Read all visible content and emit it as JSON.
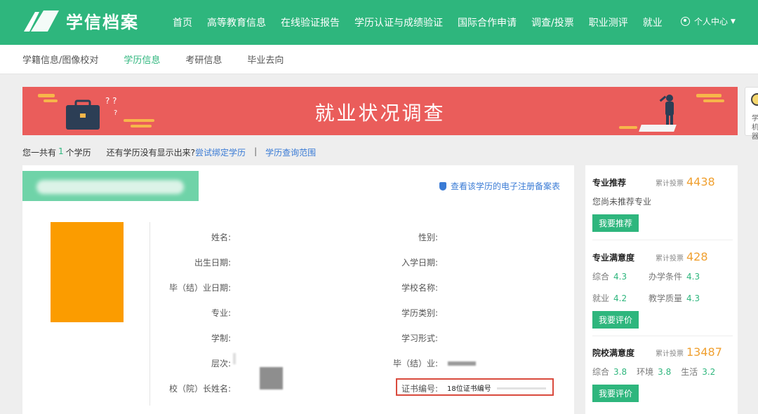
{
  "app": {
    "logo_text": "学信档案",
    "brand_color": "#2eb67d"
  },
  "nav": {
    "items": [
      "首页",
      "高等教育信息",
      "在线验证报告",
      "学历认证与成绩验证",
      "国际合作申请",
      "调查/投票",
      "职业测评",
      "就业"
    ],
    "user_menu": "个人中心"
  },
  "subnav": {
    "items": [
      "学籍信息/图像校对",
      "学历信息",
      "考研信息",
      "毕业去向"
    ],
    "active_index": 1
  },
  "banner": {
    "title": "就业状况调查",
    "color": "#ea5d5b"
  },
  "side_widget": {
    "label_1": "学",
    "label_2": "机器"
  },
  "info": {
    "prefix": "您一共有",
    "count": "1",
    "suffix": "个学历",
    "question": "还有学历没有显示出来?",
    "bind_link": "尝试绑定学历",
    "separator": "|",
    "scope_link": "学历查询范围"
  },
  "record": {
    "record_link": "查看该学历的电子注册备案表",
    "fields_left": [
      "姓名:",
      "出生日期:",
      "毕（结）业日期:",
      "专业:",
      "学制:",
      "层次:",
      "校（院）长姓名:"
    ],
    "fields_right": [
      "性别:",
      "入学日期:",
      "学校名称:",
      "学历类别:",
      "学习形式:",
      "毕（结）业:",
      "证书编号:"
    ],
    "certificate_number": "18位证书编号",
    "highlight_color": "#d94a3d"
  },
  "panel": {
    "major": {
      "title": "专业推荐",
      "vote_label": "累计投票",
      "vote_count": "4438",
      "text": "您尚未推荐专业",
      "button": "我要推荐"
    },
    "major_satisfaction": {
      "title": "专业满意度",
      "vote_label": "累计投票",
      "vote_count": "428",
      "stats": [
        {
          "label": "综合",
          "value": "4.3"
        },
        {
          "label": "办学条件",
          "value": "4.3"
        },
        {
          "label": "就业",
          "value": "4.2"
        },
        {
          "label": "教学质量",
          "value": "4.3"
        }
      ],
      "button": "我要评价"
    },
    "school_satisfaction": {
      "title": "院校满意度",
      "vote_label": "累计投票",
      "vote_count": "13487",
      "stats": [
        {
          "label": "综合",
          "value": "3.8"
        },
        {
          "label": "环境",
          "value": "3.8"
        },
        {
          "label": "生活",
          "value": "3.2"
        }
      ],
      "button": "我要评价"
    }
  }
}
